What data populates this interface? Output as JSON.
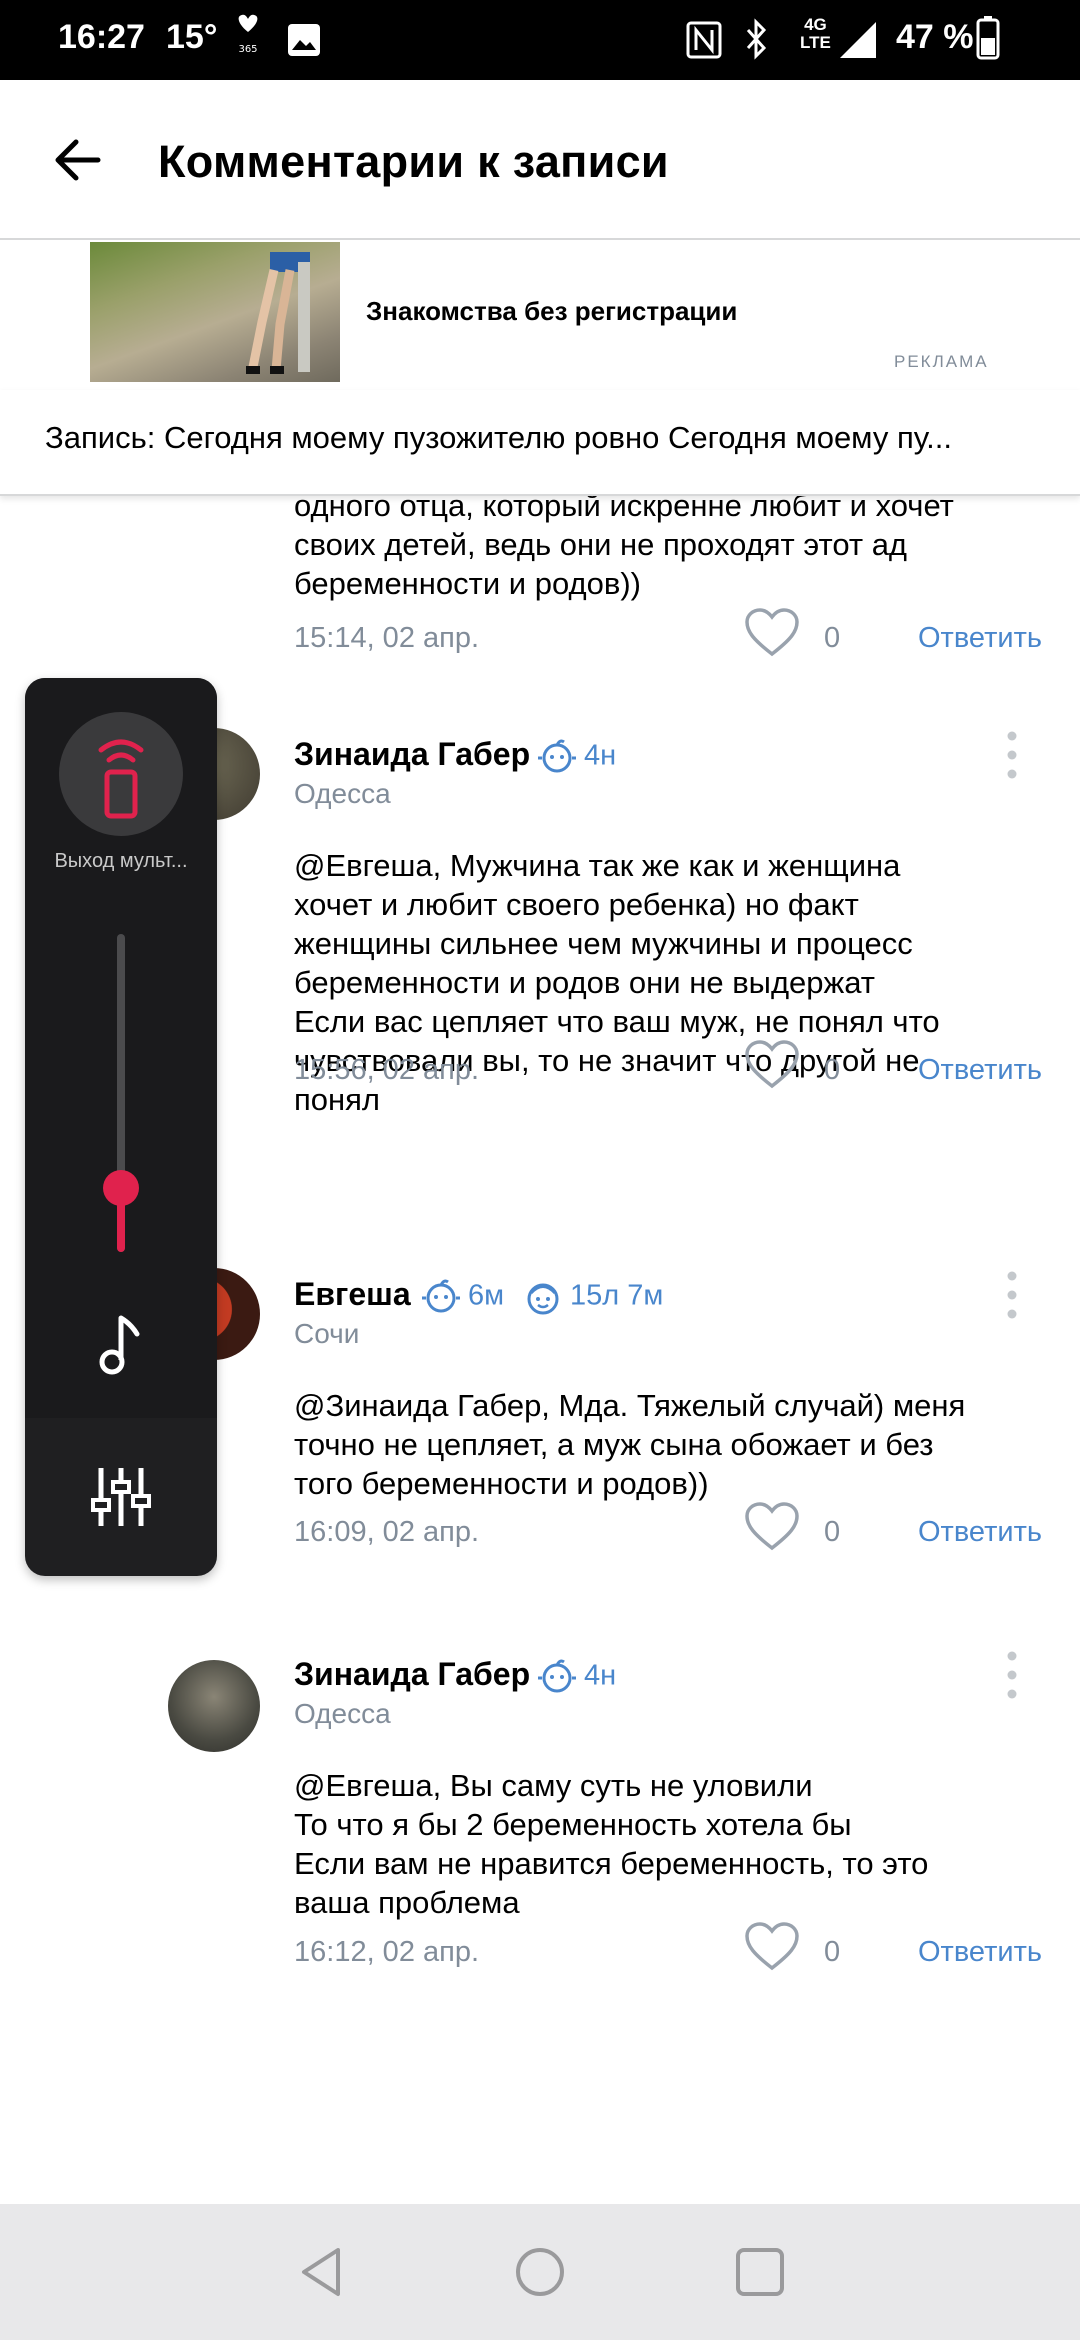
{
  "status_bar": {
    "time": "16:27",
    "temperature": "15°",
    "network": [
      "4G",
      "LTE"
    ],
    "battery": "47 %"
  },
  "header": {
    "title": "Комментарии к записи"
  },
  "ad": {
    "title": "Знакомства без регистрации",
    "label": "РЕКЛАМА"
  },
  "record": {
    "text": "Запись: Сегодня моему пузожителю ровно Сегодня моему пу..."
  },
  "comments": [
    {
      "body_partial": "одного отца, который искренне любит и хочет\nсвоих детей, ведь они не проходят этот ад\nбеременности и родов))",
      "date": "15:14, 02 апр.",
      "likes": "0",
      "reply": "Ответить"
    },
    {
      "name": "Зинаида Габер",
      "badge": "4н",
      "city": "Одесса",
      "body": "@Евгеша, Мужчина так же как и женщина\nхочет и любит своего ребенка) но факт\nженщины сильнее чем мужчины и процесс\nбеременности и родов они не выдержат\nЕсли вас цепляет что ваш муж, не понял что\nчувствовали вы, то не значит что другой не\nпонял",
      "date": "15:56, 02 апр.",
      "likes": "0",
      "reply": "Ответить"
    },
    {
      "name": "Евгеша",
      "badge": "6м",
      "badge2": "15л 7м",
      "city": "Сочи",
      "body": "@Зинаида Габер, Мда. Тяжелый случай) меня\nточно не цепляет, а муж сына обожает и без\nтого беременности и родов))",
      "date": "16:09, 02 апр.",
      "likes": "0",
      "reply": "Ответить"
    },
    {
      "name": "Зинаида Габер",
      "badge": "4н",
      "city": "Одесса",
      "body": "@Евгеша, Вы саму суть не уловили\nТо что я бы 2 беременность хотела бы\nЕсли вам не нравится беременность, то это\nваша проблема",
      "date": "16:12, 02 апр.",
      "likes": "0",
      "reply": "Ответить"
    }
  ],
  "volume_panel": {
    "cast_label": "Выход мульт...",
    "level": 0.2,
    "accent": "#e0224d"
  },
  "colors": {
    "link": "#4986cc",
    "secondary": "#818c99"
  },
  "icons": [
    "back-arrow-icon",
    "heart-icon",
    "more-vertical-icon",
    "baby-icon",
    "child-icon",
    "music-note-icon",
    "equalizer-icon",
    "cast-device-icon"
  ]
}
